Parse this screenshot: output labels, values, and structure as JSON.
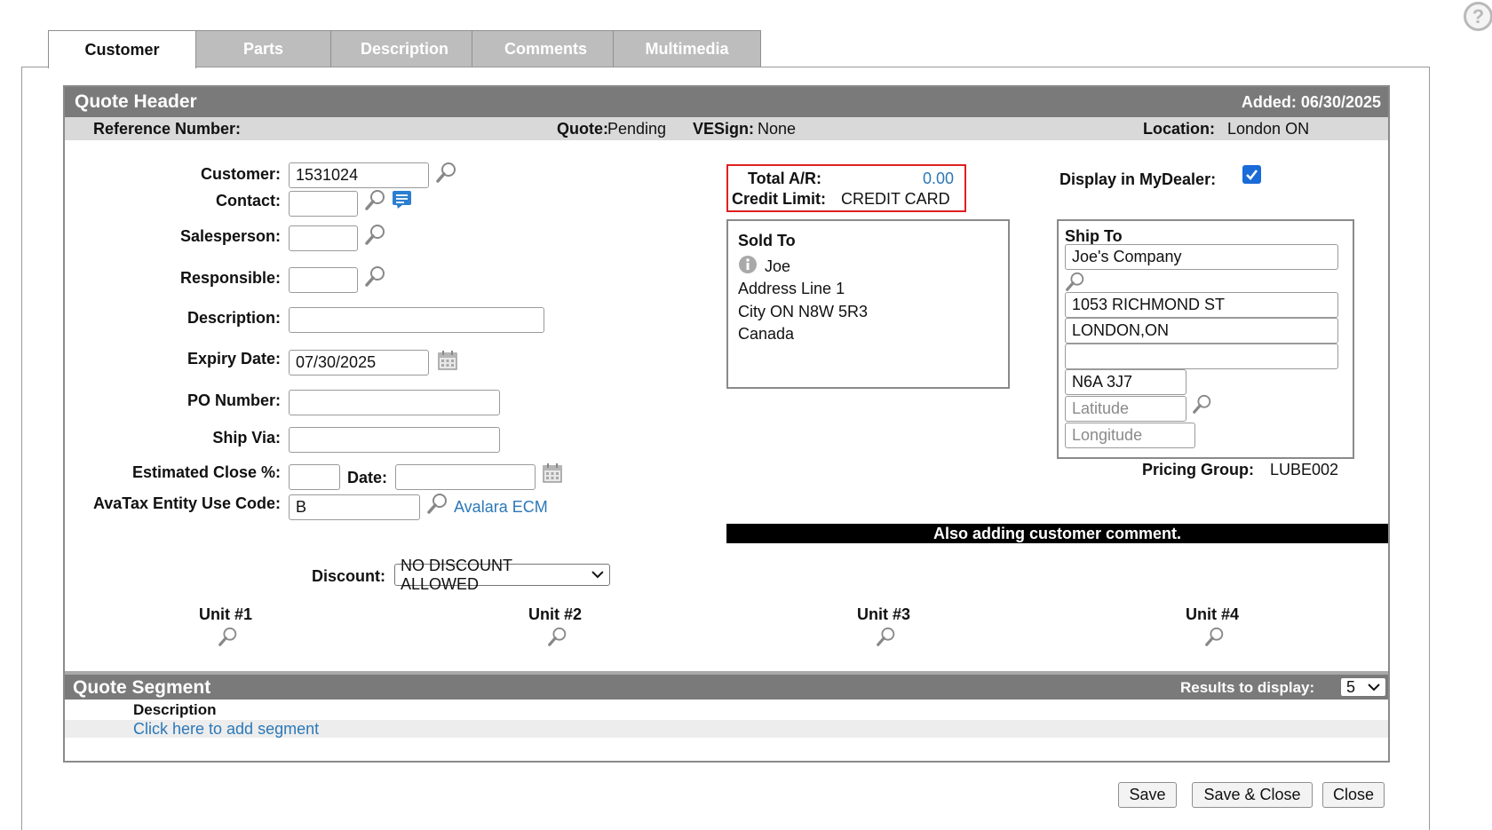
{
  "tabs": [
    "Customer",
    "Parts",
    "Description",
    "Comments",
    "Multimedia"
  ],
  "quote_header": {
    "title": "Quote Header",
    "added": "Added: 06/30/2025",
    "reference_label": "Reference Number:",
    "quote_label": "Quote:",
    "quote_value": "Pending",
    "vesign_label": "VESign:",
    "vesign_value": "None",
    "location_label": "Location:",
    "location_value": "London ON"
  },
  "form": {
    "customer_label": "Customer:",
    "customer_value": "1531024",
    "contact_label": "Contact:",
    "contact_value": "",
    "salesperson_label": "Salesperson:",
    "salesperson_value": "",
    "responsible_label": "Responsible:",
    "responsible_value": "",
    "description_label": "Description:",
    "description_value": "",
    "expiry_label": "Expiry Date:",
    "expiry_value": "07/30/2025",
    "po_label": "PO Number:",
    "po_value": "",
    "shipvia_label": "Ship Via:",
    "shipvia_value": "",
    "est_close_label": "Estimated Close %:",
    "est_close_value": "",
    "date_label": "Date:",
    "date_value": "",
    "avatax_label": "AvaTax Entity Use Code:",
    "avatax_value": "B",
    "avalara_link": "Avalara ECM",
    "discount_label": "Discount:",
    "discount_value": "NO DISCOUNT ALLOWED"
  },
  "ar": {
    "total_label": "Total A/R:",
    "total_value": "0.00",
    "credit_label": "Credit Limit:",
    "credit_value": "CREDIT CARD"
  },
  "display_mydealer": {
    "label": "Display in MyDealer:",
    "checked": true
  },
  "sold_to": {
    "title": "Sold To",
    "name": "Joe",
    "line1": "Address Line 1",
    "line2": "City ON N8W 5R3",
    "line3": "Canada"
  },
  "ship_to": {
    "title": "Ship To",
    "company": "Joe's Company",
    "address1": "1053 RICHMOND ST",
    "address2": "LONDON,ON",
    "address3": "",
    "postal": "N6A 3J7",
    "latitude_placeholder": "Latitude",
    "longitude_placeholder": "Longitude"
  },
  "pricing_group": {
    "label": "Pricing Group:",
    "value": "LUBE002"
  },
  "notice": "Also adding customer comment.",
  "units": [
    "Unit #1",
    "Unit #2",
    "Unit #3",
    "Unit #4"
  ],
  "quote_segment": {
    "title": "Quote Segment",
    "results_label": "Results to display:",
    "results_value": "5",
    "column_header": "Description",
    "add_link": "Click here to add segment"
  },
  "buttons": {
    "save": "Save",
    "save_close": "Save & Close",
    "close": "Close"
  },
  "colors": {
    "header_bar": "#7a7a7a",
    "subheader_bar": "#d9d9d9",
    "link": "#2b78b8",
    "ar_border": "#e02020",
    "notice_bar": "#000000",
    "checkbox": "#1a6ad8"
  }
}
